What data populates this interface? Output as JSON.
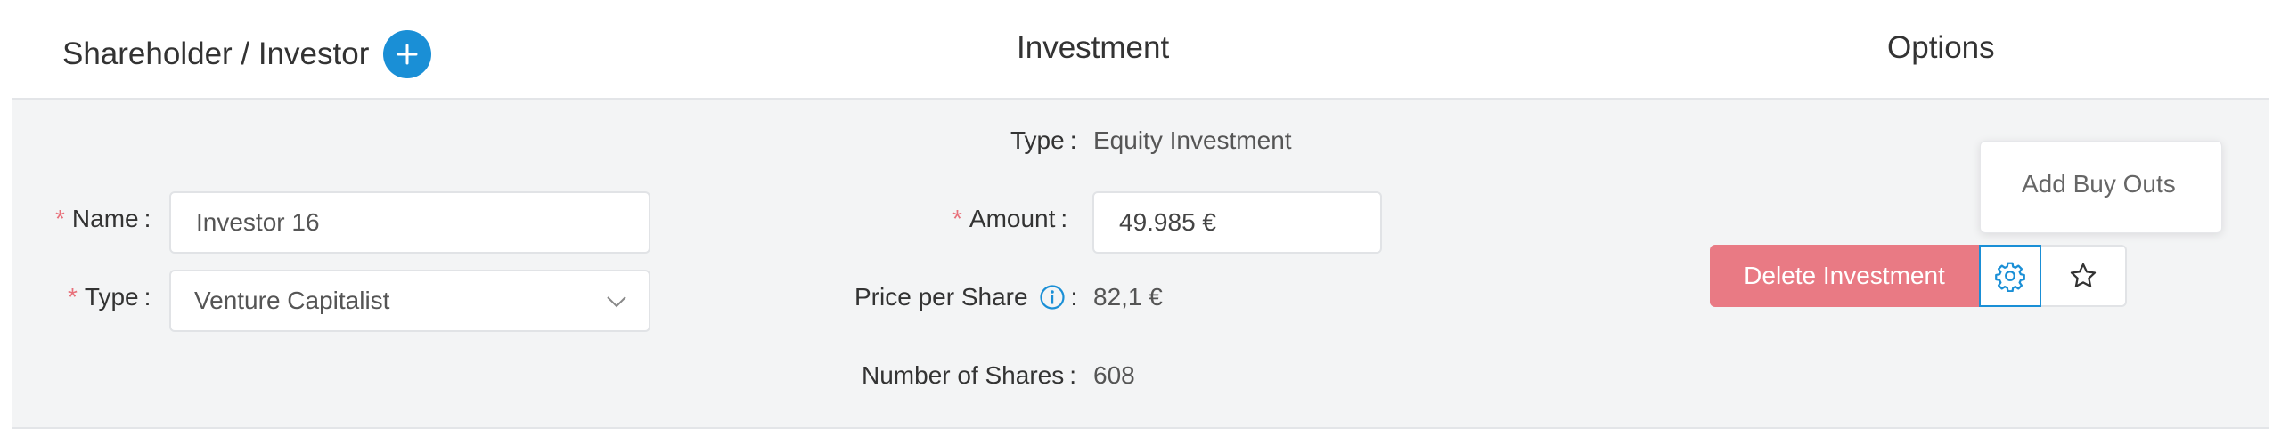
{
  "header": {
    "shareholder_title": "Shareholder / Investor",
    "investment_title": "Investment",
    "options_title": "Options",
    "add_icon": "plus-icon"
  },
  "shareholder": {
    "name_required": "*",
    "name_label": "Name",
    "name_value": "Investor 16",
    "type_required": "*",
    "type_label": "Type",
    "type_value": "Venture Capitalist",
    "type_icon": "chevron-down-icon"
  },
  "investment": {
    "type_label": "Type",
    "type_value": "Equity Investment",
    "amount_required": "*",
    "amount_label": "Amount",
    "amount_value": "49.985 €",
    "price_label": "Price per Share",
    "price_icon": "info-icon",
    "price_value": "82,1 €",
    "shares_label": "Number of Shares",
    "shares_value": "608",
    "separator": ":"
  },
  "options": {
    "delete_label": "Delete Investment",
    "gear_icon": "gear-icon",
    "star_icon": "star-icon",
    "menu_item": "Add Buy Outs"
  },
  "colors": {
    "accent": "#1a8fd6",
    "danger": "#e97a84",
    "row_bg": "#f3f4f5",
    "required": "#e8707a"
  }
}
